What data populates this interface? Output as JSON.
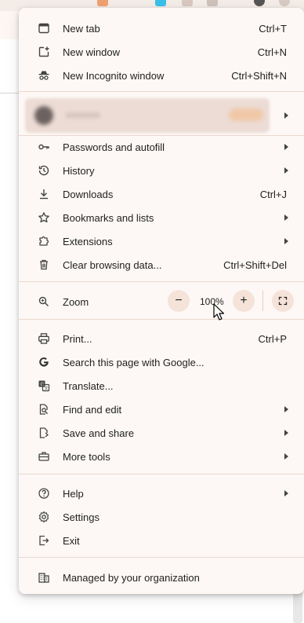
{
  "menu": {
    "items_top": [
      {
        "label": "New tab",
        "shortcut": "Ctrl+T",
        "icon": "new-tab-icon"
      },
      {
        "label": "New window",
        "shortcut": "Ctrl+N",
        "icon": "new-window-icon"
      },
      {
        "label": "New Incognito window",
        "shortcut": "Ctrl+Shift+N",
        "icon": "incognito-icon"
      }
    ],
    "items_main": [
      {
        "label": "Passwords and autofill",
        "shortcut": "",
        "icon": "key-icon"
      },
      {
        "label": "History",
        "shortcut": "",
        "icon": "history-icon"
      },
      {
        "label": "Downloads",
        "shortcut": "Ctrl+J",
        "icon": "download-icon"
      },
      {
        "label": "Bookmarks and lists",
        "shortcut": "",
        "icon": "star-icon"
      },
      {
        "label": "Extensions",
        "shortcut": "",
        "icon": "puzzle-icon"
      },
      {
        "label": "Clear browsing data...",
        "shortcut": "Ctrl+Shift+Del",
        "icon": "trash-icon"
      }
    ],
    "zoom": {
      "label": "Zoom",
      "value": "100%",
      "minus": "−",
      "plus": "+"
    },
    "items_tools": [
      {
        "label": "Print...",
        "shortcut": "Ctrl+P",
        "icon": "print-icon"
      },
      {
        "label": "Search this page with Google...",
        "shortcut": "",
        "icon": "google-icon"
      },
      {
        "label": "Translate...",
        "shortcut": "",
        "icon": "translate-icon"
      },
      {
        "label": "Find and edit",
        "shortcut": "",
        "icon": "find-icon"
      },
      {
        "label": "Save and share",
        "shortcut": "",
        "icon": "save-share-icon"
      },
      {
        "label": "More tools",
        "shortcut": "",
        "icon": "toolbox-icon"
      }
    ],
    "items_help": [
      {
        "label": "Help",
        "shortcut": "",
        "icon": "help-icon"
      },
      {
        "label": "Settings",
        "shortcut": "",
        "icon": "gear-icon"
      },
      {
        "label": "Exit",
        "shortcut": "",
        "icon": "exit-icon"
      }
    ],
    "managed": {
      "label": "Managed by your organization",
      "icon": "building-icon"
    }
  },
  "colors": {
    "menu_bg": "#fdf8f5",
    "zoom_btn_bg": "#f5e3da",
    "separator": "#ead9cf"
  }
}
